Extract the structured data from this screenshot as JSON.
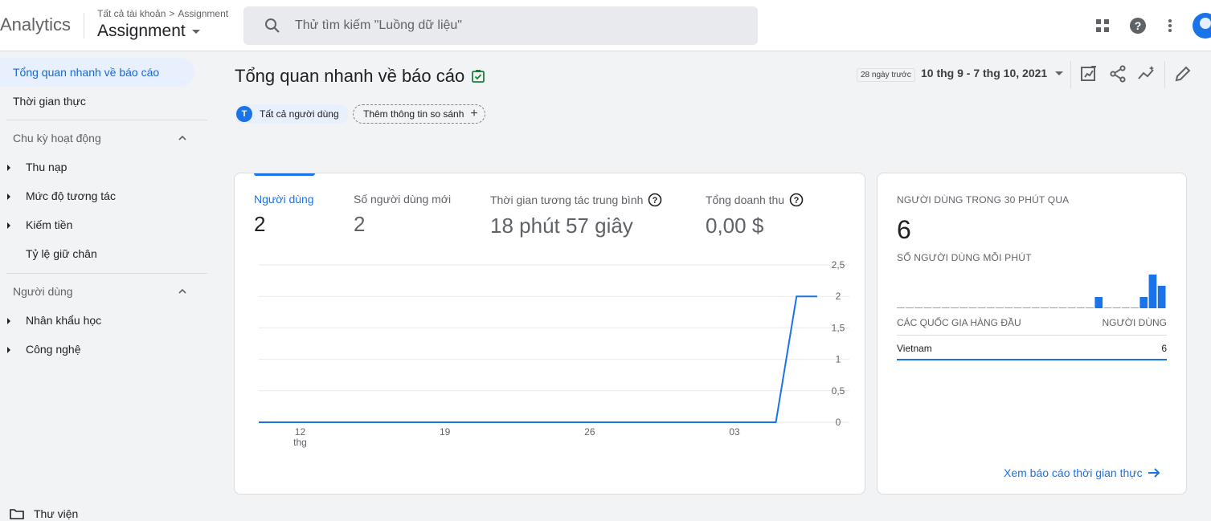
{
  "header": {
    "brand": "Analytics",
    "breadcrumb_root": "Tất cả tài khoản",
    "breadcrumb_sep": ">",
    "breadcrumb_leaf": "Assignment",
    "account": "Assignment",
    "search_placeholder": "Thử tìm kiếm \"Luồng dữ liệu\"",
    "icons": [
      "apps-grid-icon",
      "help-icon",
      "more-vert-icon",
      "account-avatar"
    ]
  },
  "sidebar": {
    "items": [
      {
        "label": "Tổng quan nhanh về báo cáo",
        "active": true
      },
      {
        "label": "Thời gian thực"
      }
    ],
    "sections": [
      {
        "label": "Chu kỳ hoạt động",
        "items": [
          "Thu nạp",
          "Mức độ tương tác",
          "Kiếm tiền",
          "Tỷ lệ giữ chân"
        ]
      },
      {
        "label": "Người dùng",
        "items": [
          "Nhân khẩu học",
          "Công nghệ"
        ]
      }
    ],
    "library": "Thư viện"
  },
  "main": {
    "title": "Tổng quan nhanh về báo cáo",
    "date_chip": "28 ngày trước",
    "date_range": "10 thg 9 - 7 thg 10, 2021",
    "toolbar_icons": [
      "customize-report-icon",
      "share-icon",
      "insights-icon",
      "edit-pencil-icon"
    ],
    "comparison": {
      "avatar_letter": "T",
      "all_users": "Tất cả người dùng",
      "add_label": "Thêm thông tin so sánh"
    }
  },
  "metrics": [
    {
      "label": "Người dùng",
      "value": "2",
      "selected": true
    },
    {
      "label": "Số người dùng mới",
      "value": "2"
    },
    {
      "label": "Thời gian tương tác trung bình",
      "value": "18 phút 57 giây",
      "help": true
    },
    {
      "label": "Tổng doanh thu",
      "value": "0,00 $",
      "help": true
    }
  ],
  "chart_data": {
    "type": "line",
    "x_tick_labels": [
      "12",
      "19",
      "26",
      "03"
    ],
    "x_tick_sublabel": "thg",
    "y_tick_labels": [
      "0",
      "0,5",
      "1",
      "1,5",
      "2",
      "2,5"
    ],
    "ylim": [
      0,
      2.5
    ],
    "x": [
      "10/9",
      "11/9",
      "12/9",
      "13/9",
      "14/9",
      "15/9",
      "16/9",
      "17/9",
      "18/9",
      "19/9",
      "20/9",
      "21/9",
      "22/9",
      "23/9",
      "24/9",
      "25/9",
      "26/9",
      "27/9",
      "28/9",
      "29/9",
      "30/9",
      "1/10",
      "2/10",
      "3/10",
      "4/10",
      "5/10",
      "6/10",
      "7/10"
    ],
    "series": [
      {
        "values": [
          0,
          0,
          0,
          0,
          0,
          0,
          0,
          0,
          0,
          0,
          0,
          0,
          0,
          0,
          0,
          0,
          0,
          0,
          0,
          0,
          0,
          0,
          0,
          0,
          0,
          0,
          2,
          2
        ]
      }
    ],
    "color": "#1a73e8",
    "grid": true
  },
  "realtime": {
    "heading": "NGƯỜI DÙNG TRONG 30 PHÚT QUA",
    "value": "6",
    "per_minute_heading": "SỐ NGƯỜI DÙNG MỖI PHÚT",
    "per_minute": [
      0,
      0,
      0,
      0,
      0,
      0,
      0,
      0,
      0,
      0,
      0,
      0,
      0,
      0,
      0,
      0,
      0,
      0,
      0,
      0,
      0,
      0,
      1,
      0,
      0,
      0,
      0,
      1,
      3,
      2
    ],
    "col_country": "CÁC QUỐC GIA HÀNG ĐẦU",
    "col_users": "NGƯỜI DÙNG",
    "rows": [
      {
        "country": "Vietnam",
        "users": "6"
      }
    ],
    "link": "Xem báo cáo thời gian thực"
  }
}
